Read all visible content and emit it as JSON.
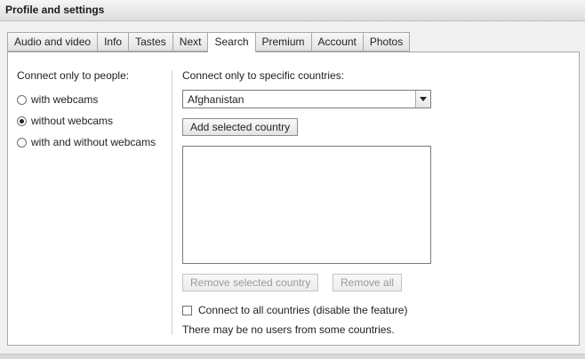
{
  "window": {
    "title": "Profile and settings"
  },
  "tabs": [
    {
      "label": "Audio and video",
      "active": false
    },
    {
      "label": "Info",
      "active": false
    },
    {
      "label": "Tastes",
      "active": false
    },
    {
      "label": "Next",
      "active": false
    },
    {
      "label": "Search",
      "active": true
    },
    {
      "label": "Premium",
      "active": false
    },
    {
      "label": "Account",
      "active": false
    },
    {
      "label": "Photos",
      "active": false
    }
  ],
  "people": {
    "heading": "Connect only to people:",
    "options": [
      {
        "label": "with webcams",
        "checked": false
      },
      {
        "label": "without webcams",
        "checked": true
      },
      {
        "label": "with and without webcams",
        "checked": false
      }
    ]
  },
  "countries": {
    "heading": "Connect only to specific countries:",
    "selected_country": "Afghanistan",
    "add_button": "Add selected country",
    "list_items": [],
    "remove_selected_button": "Remove selected country",
    "remove_all_button": "Remove all",
    "all_countries_checkbox": "Connect to all countries (disable the feature)",
    "all_countries_checked": false,
    "note": "There may be no users from some countries."
  }
}
